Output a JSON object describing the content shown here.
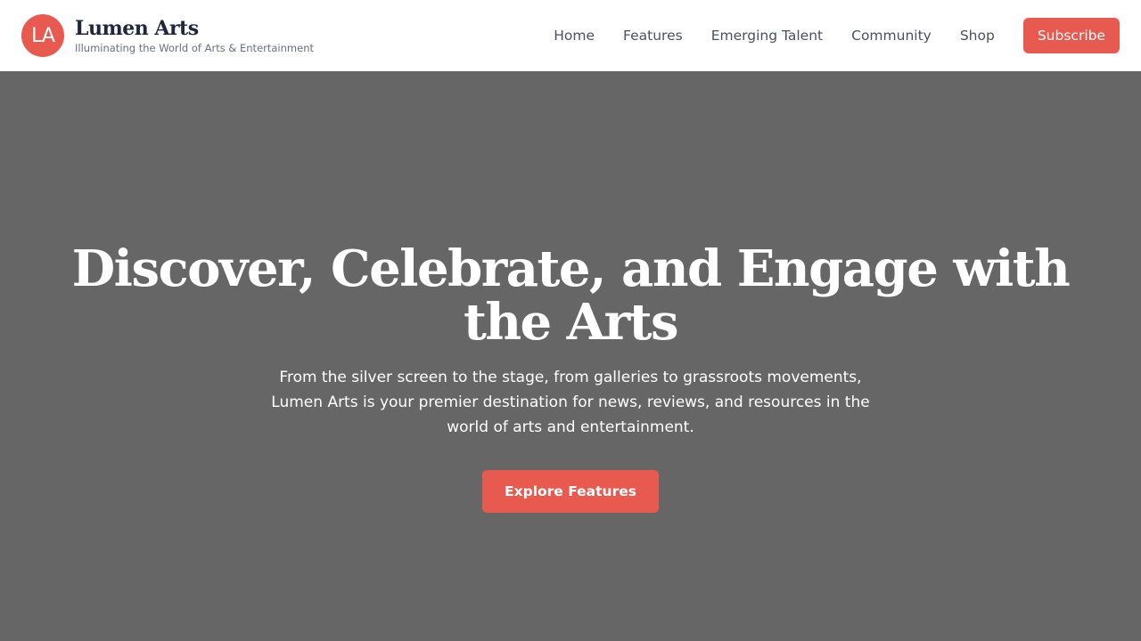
{
  "brand": {
    "logo_initials": "LA",
    "name": "Lumen Arts",
    "tagline": "Illuminating the World of Arts & Entertainment"
  },
  "nav": {
    "items": [
      {
        "label": "Home"
      },
      {
        "label": "Features"
      },
      {
        "label": "Emerging Talent"
      },
      {
        "label": "Community"
      },
      {
        "label": "Shop"
      }
    ],
    "subscribe_label": "Subscribe"
  },
  "hero": {
    "title": "Discover, Celebrate, and Engage with the Arts",
    "text": "From the silver screen to the stage, from galleries to grassroots movements, Lumen Arts is your premier destination for news, reviews, and resources in the world of arts and entertainment.",
    "cta_label": "Explore Features"
  },
  "colors": {
    "accent": "#e8594f",
    "hero_background": "#666666",
    "brand_text": "#1f2640",
    "nav_text": "#4a5060"
  }
}
